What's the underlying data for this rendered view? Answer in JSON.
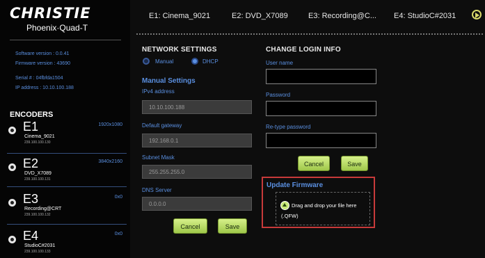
{
  "brand": {
    "name": "CHRISTIE",
    "product": "Phoenix·Quad-T"
  },
  "info": {
    "software": "Software version : 0.0.41",
    "firmware": "Firmware version : 43690",
    "serial": "Serial # : 04fbfda1504",
    "ip": "IP address : 10.10.100.188"
  },
  "encoders_title": "ENCODERS",
  "encoders": [
    {
      "id": "E1",
      "name": "Cinema_9021",
      "ip": "239.100.100.130",
      "res": "1920x1080"
    },
    {
      "id": "E2",
      "name": "DVD_X7089",
      "ip": "239.100.100.131",
      "res": "3840x2160"
    },
    {
      "id": "E3",
      "name": "Recording@CRT",
      "ip": "239.100.100.132",
      "res": "0x0"
    },
    {
      "id": "E4",
      "name": "StudioC#2031",
      "ip": "239.100.100.133",
      "res": "0x0"
    }
  ],
  "tabs": [
    "E1: Cinema_9021",
    "E2: DVD_X7089",
    "E3: Recording@C...",
    "E4: StudioC#2031"
  ],
  "network": {
    "title": "NETWORK SETTINGS",
    "manual_label": "Manual",
    "dhcp_label": "DHCP",
    "manual_settings": "Manual Settings",
    "ipv4_label": "IPv4 address",
    "ipv4_value": "10.10.100.188",
    "gateway_label": "Default gateway",
    "gateway_value": "192.168.0.1",
    "subnet_label": "Subnet Mask",
    "subnet_value": "255.255.255.0",
    "dns_label": "DNS Server",
    "dns_value": "0.0.0.0",
    "cancel": "Cancel",
    "save": "Save"
  },
  "login": {
    "title": "CHANGE LOGIN INFO",
    "username_label": "User name",
    "password_label": "Password",
    "retype_label": "Re-type password",
    "cancel": "Cancel",
    "save": "Save"
  },
  "firmware": {
    "title": "Update Firmware",
    "drop_text": "Drag and drop your file here",
    "ext": "(.QFW)"
  },
  "colors": {
    "accent_blue": "#5a8fe0",
    "button_green": "#c8e878",
    "highlight_red": "#c83a3a"
  }
}
